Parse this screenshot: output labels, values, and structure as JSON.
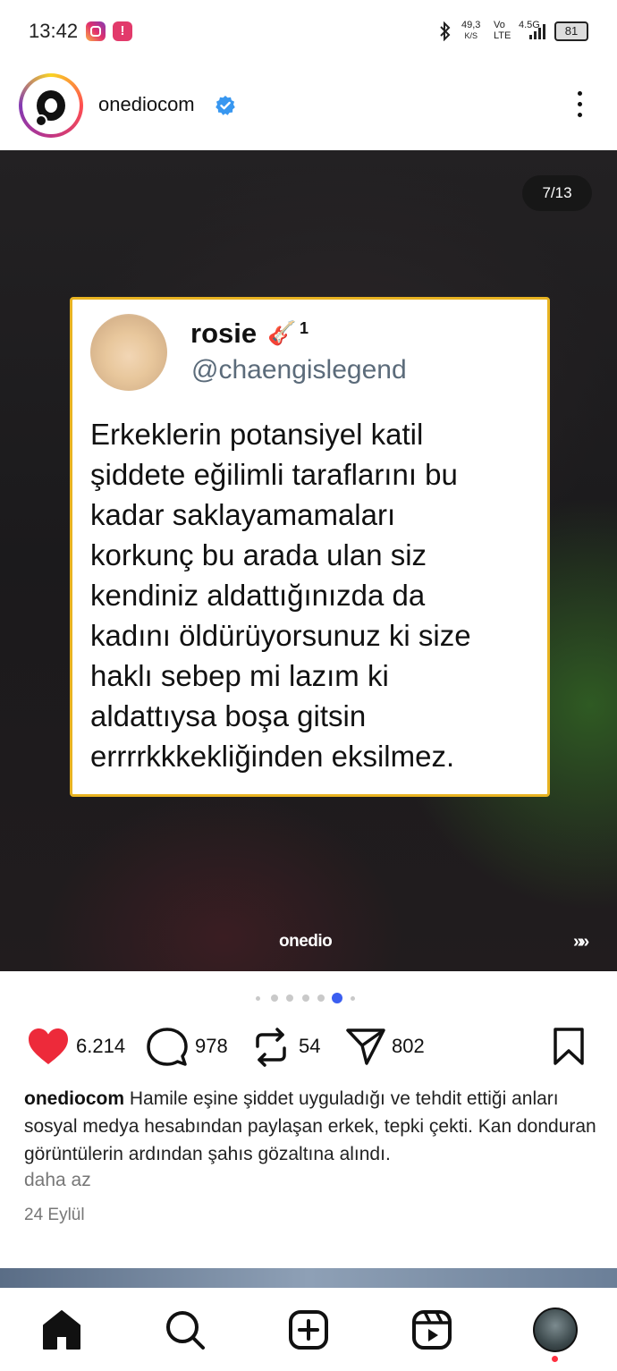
{
  "status_bar": {
    "time": "13:42",
    "net_speed_value": "49,3",
    "net_speed_unit": "K/S",
    "volte_top": "Vo",
    "volte_bottom": "LTE",
    "network_type": "4.5G",
    "battery": "81"
  },
  "post": {
    "username": "onediocom",
    "verified": true,
    "slide_counter": "7/13",
    "watermark": "onedio",
    "next_arrows": "»»",
    "tweet": {
      "name": "rosie",
      "name_emoji": "🎸",
      "name_sup": "1",
      "handle": "@chaengislegend",
      "lines": [
        "Erkeklerin potansiyel katil",
        "şiddete eğilimli taraflarını bu",
        "kadar saklayamamaları",
        "korkunç bu arada ulan siz",
        "kendiniz aldattığınızda da",
        "kadını öldürüyorsunuz ki size",
        "haklı sebep mi lazım ki",
        "aldattıysa boşa gitsin",
        "errrrkkkekliğinden eksilmez."
      ]
    },
    "likes": "6.214",
    "comments": "978",
    "reposts": "54",
    "shares": "802",
    "caption_user": "onediocom",
    "caption_text": "Hamile eşine şiddet uyguladığı ve tehdit ettiği anları sosyal medya hesabından paylaşan erkek, tepki çekti. Kan donduran görüntülerin ardından şahıs gözaltına alındı.",
    "less_label": "daha az",
    "date": "24 Eylül"
  },
  "colors": {
    "like": "#ed2a3a",
    "verified": "#3897f0",
    "tweet_border": "#e8b321",
    "dot_active": "#3b5ef0"
  },
  "icons": [
    "bluetooth-icon",
    "verified-badge-icon",
    "more-icon",
    "heart-icon",
    "comment-icon",
    "repost-icon",
    "share-icon",
    "bookmark-icon",
    "home-icon",
    "search-icon",
    "create-icon",
    "reels-icon"
  ]
}
